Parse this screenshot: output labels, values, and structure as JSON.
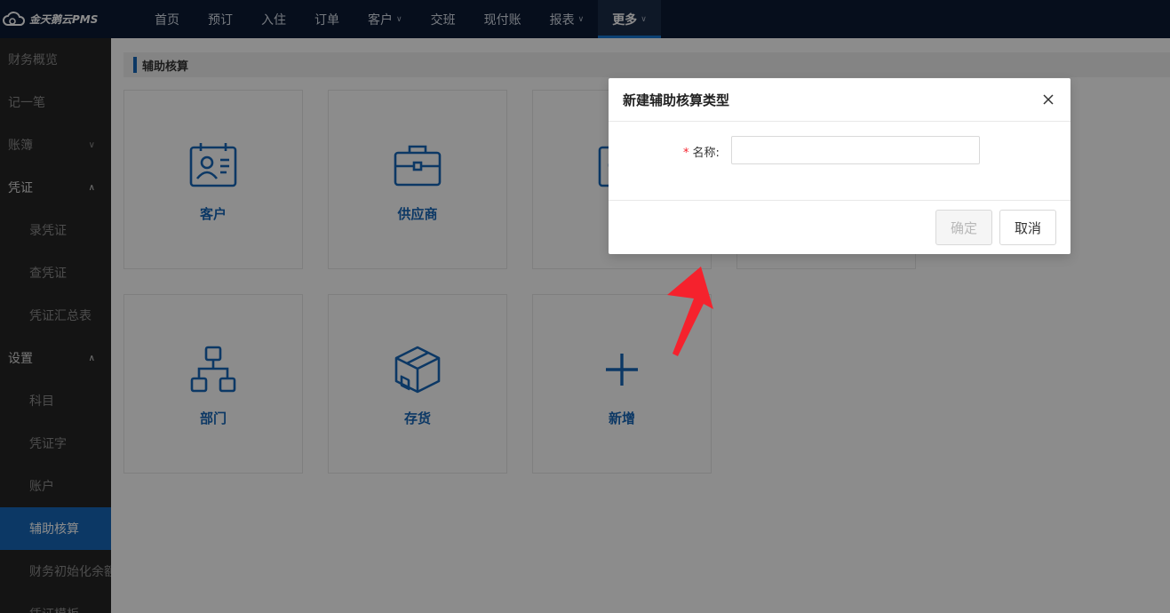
{
  "app": {
    "logo_text": "金天鹅云PMS"
  },
  "nav": {
    "items": [
      {
        "label": "首页",
        "has_dropdown": false
      },
      {
        "label": "预订",
        "has_dropdown": false
      },
      {
        "label": "入住",
        "has_dropdown": false
      },
      {
        "label": "订单",
        "has_dropdown": false
      },
      {
        "label": "客户",
        "has_dropdown": true
      },
      {
        "label": "交班",
        "has_dropdown": false
      },
      {
        "label": "现付账",
        "has_dropdown": false
      },
      {
        "label": "报表",
        "has_dropdown": true
      },
      {
        "label": "更多",
        "has_dropdown": true,
        "active": true
      }
    ]
  },
  "sidebar": {
    "items": [
      {
        "label": "财务概览",
        "type": "top"
      },
      {
        "label": "记一笔",
        "type": "top"
      },
      {
        "label": "账簿",
        "type": "top",
        "arrow": "down"
      },
      {
        "label": "凭证",
        "type": "group",
        "arrow": "up"
      },
      {
        "label": "录凭证",
        "type": "sub"
      },
      {
        "label": "查凭证",
        "type": "sub"
      },
      {
        "label": "凭证汇总表",
        "type": "sub"
      },
      {
        "label": "设置",
        "type": "group",
        "arrow": "up"
      },
      {
        "label": "科目",
        "type": "sub"
      },
      {
        "label": "凭证字",
        "type": "sub"
      },
      {
        "label": "账户",
        "type": "sub"
      },
      {
        "label": "辅助核算",
        "type": "sub",
        "active": true
      },
      {
        "label": "财务初始化余额",
        "type": "sub"
      },
      {
        "label": "凭证模板",
        "type": "sub"
      }
    ]
  },
  "main": {
    "section_title": "辅助核算",
    "cards": [
      {
        "label": "客户",
        "icon": "contact-card-icon"
      },
      {
        "label": "供应商",
        "icon": "briefcase-icon"
      },
      {
        "label": "",
        "icon": "person-icon"
      },
      {
        "label": "",
        "icon": ""
      },
      {
        "label": "部门",
        "icon": "org-chart-icon"
      },
      {
        "label": "存货",
        "icon": "box-icon"
      },
      {
        "label": "新增",
        "icon": "plus-icon"
      }
    ]
  },
  "dialog": {
    "title": "新建辅助核算类型",
    "close_label": "X",
    "name_label": "名称:",
    "required_mark": "*",
    "name_value": "",
    "ok_label": "确定",
    "cancel_label": "取消"
  },
  "colors": {
    "topbar": "#0b1a33",
    "sidebar": "#262626",
    "accent": "#1667b8",
    "required": "#f5222d",
    "annotation_arrow": "#f5222d"
  }
}
